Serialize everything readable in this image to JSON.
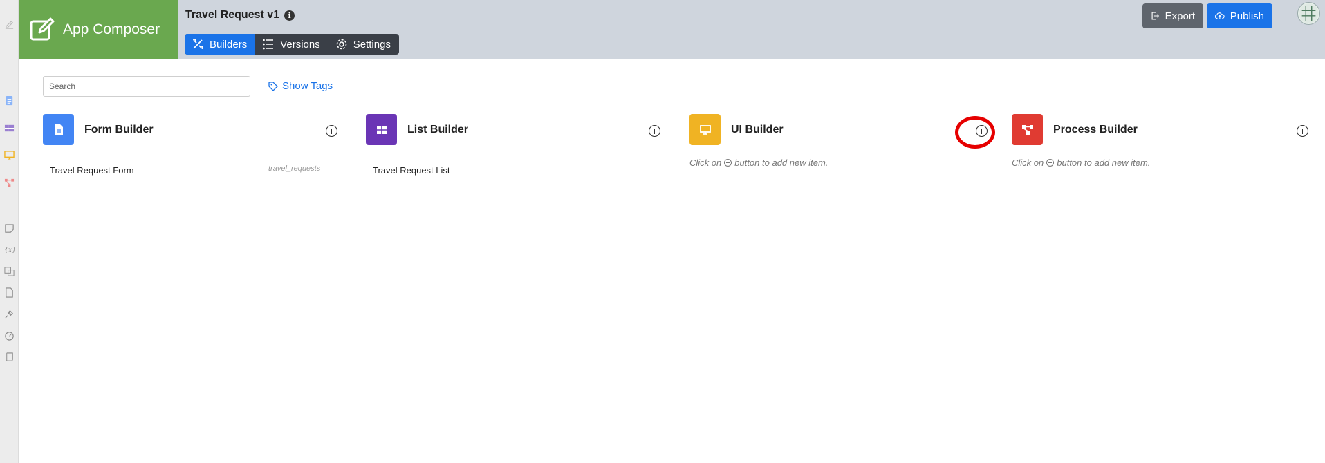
{
  "app": {
    "brand_name": "App Composer",
    "title": "Travel Request v1",
    "info_icon": "info-icon"
  },
  "tabs": [
    {
      "label": "Builders",
      "icon": "tools-icon",
      "active": true
    },
    {
      "label": "Versions",
      "icon": "list-icon",
      "active": false
    },
    {
      "label": "Settings",
      "icon": "gear-icon",
      "active": false
    }
  ],
  "header_actions": {
    "export_label": "Export",
    "publish_label": "Publish"
  },
  "toolbar": {
    "search_placeholder": "Search",
    "show_tags_label": "Show Tags"
  },
  "builders": [
    {
      "title": "Form Builder",
      "color": "#4285f4",
      "icon": "document-icon",
      "items": [
        {
          "label": "Travel Request Form",
          "meta": "travel_requests"
        }
      ],
      "hint": ""
    },
    {
      "title": "List Builder",
      "color": "#6a35b5",
      "icon": "table-icon",
      "items": [
        {
          "label": "Travel Request List",
          "meta": ""
        }
      ],
      "hint": ""
    },
    {
      "title": "UI Builder",
      "color": "#f0b323",
      "icon": "monitor-icon",
      "items": [],
      "hint_before": "Click on",
      "hint_after": "button to add new item."
    },
    {
      "title": "Process Builder",
      "color": "#e03b32",
      "icon": "process-icon",
      "items": [],
      "hint_before": "Click on",
      "hint_after": "button to add new item."
    }
  ],
  "colors": {
    "brand_green": "#6aa84f",
    "header_bg": "#cfd5dd",
    "primary_blue": "#1a73e8",
    "highlight_red": "#e60000"
  }
}
